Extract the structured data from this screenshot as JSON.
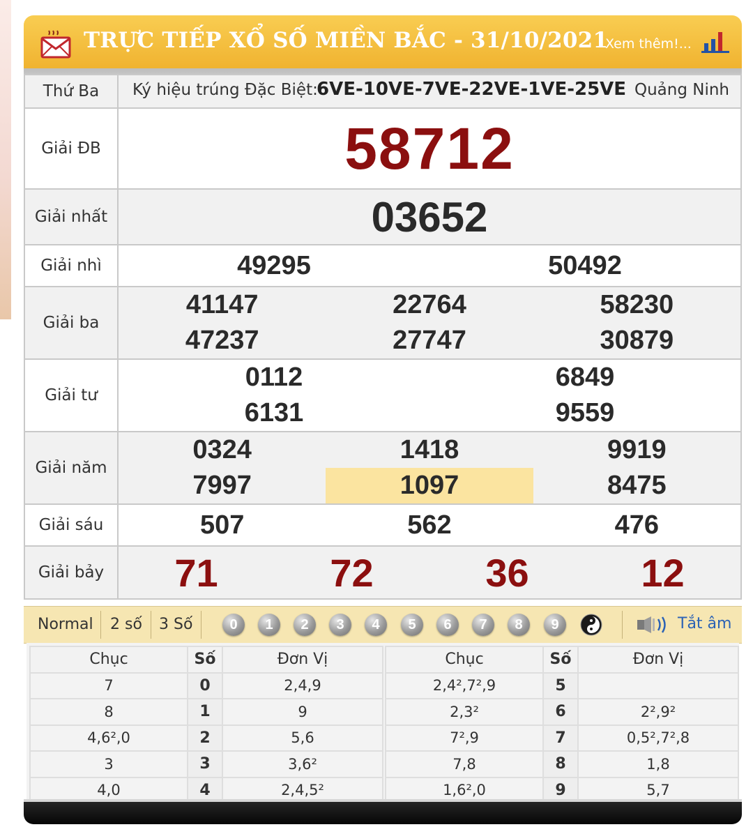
{
  "header": {
    "title": "TRỰC TIẾP XỔ SỐ MIỀN BẮC - 31/10/2021",
    "more_link": "Xem thêm!...",
    "icons": [
      "mail-icon",
      "bar-chart-icon"
    ]
  },
  "info": {
    "day": "Thứ Ba",
    "special_code_label": "Ký hiệu trúng Đặc Biệt:",
    "special_codes": "6VE-10VE-7VE-22VE-1VE-25VE",
    "province": "Quảng Ninh"
  },
  "prizes": {
    "db": {
      "label": "Giải ĐB",
      "numbers": [
        "58712"
      ]
    },
    "g1": {
      "label": "Giải nhất",
      "numbers": [
        "03652"
      ]
    },
    "g2": {
      "label": "Giải nhì",
      "numbers": [
        "49295",
        "50492"
      ]
    },
    "g3": {
      "label": "Giải ba",
      "numbers": [
        "41147",
        "22764",
        "58230",
        "47237",
        "27747",
        "30879"
      ]
    },
    "g4": {
      "label": "Giải tư",
      "numbers": [
        "0112",
        "6849",
        "6131",
        "9559"
      ]
    },
    "g5": {
      "label": "Giải năm",
      "numbers": [
        "0324",
        "1418",
        "9919",
        "7997",
        "1097",
        "8475"
      ],
      "highlighted_index": 4
    },
    "g6": {
      "label": "Giải sáu",
      "numbers": [
        "507",
        "562",
        "476"
      ]
    },
    "g7": {
      "label": "Giải bảy",
      "numbers": [
        "71",
        "72",
        "36",
        "12"
      ]
    }
  },
  "controls": {
    "modes": [
      "Normal",
      "2 số",
      "3 Số"
    ],
    "digits": [
      "0",
      "1",
      "2",
      "3",
      "4",
      "5",
      "6",
      "7",
      "8",
      "9"
    ],
    "yin_yang_icon": "yin-yang-icon",
    "speaker_icon": "speaker-icon",
    "mute_label": "Tắt âm"
  },
  "loto": {
    "headers": {
      "chuc": "Chục",
      "so": "Số",
      "donvi": "Đơn Vị"
    },
    "left": [
      {
        "chuc": "7",
        "so": "0",
        "donvi": "2,4,9"
      },
      {
        "chuc": "8",
        "so": "1",
        "donvi": "9"
      },
      {
        "chuc": "4,6²,0",
        "so": "2",
        "donvi": "5,6"
      },
      {
        "chuc": "3",
        "so": "3",
        "donvi": "3,6²"
      },
      {
        "chuc": "4,0",
        "so": "4",
        "donvi": "2,4,5²"
      }
    ],
    "right": [
      {
        "chuc": "2,4²,7²,9",
        "so": "5",
        "donvi": ""
      },
      {
        "chuc": "2,3²",
        "so": "6",
        "donvi": "2²,9²"
      },
      {
        "chuc": "7²,9",
        "so": "7",
        "donvi": "0,5²,7²,8"
      },
      {
        "chuc": "7,8",
        "so": "8",
        "donvi": "1,8"
      },
      {
        "chuc": "1,6²,0",
        "so": "9",
        "donvi": "5,7"
      }
    ]
  },
  "colors": {
    "header_bg": "#f0b330",
    "special_number": "#8b0f0f",
    "highlight": "#fbe4a0",
    "control_bar": "#f6e6b2",
    "link": "#2b62b5"
  }
}
